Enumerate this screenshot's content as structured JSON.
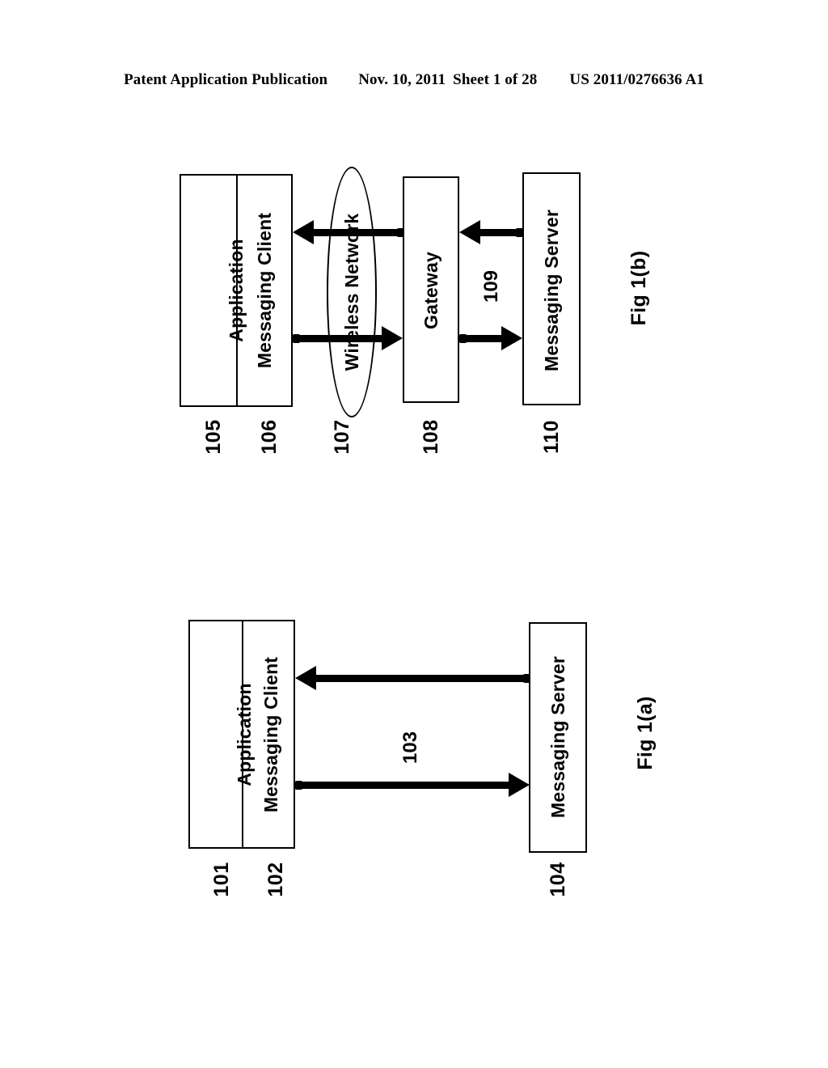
{
  "header": {
    "publication": "Patent Application Publication",
    "date": "Nov. 10, 2011",
    "sheet": "Sheet 1 of 28",
    "publication_number": "US 2011/0276636 A1"
  },
  "figures": [
    {
      "caption": "Fig 1(b)",
      "nodes": [
        {
          "label": "Application",
          "ref": "105"
        },
        {
          "label": "Messaging Client",
          "ref": "106"
        },
        {
          "label": "Wireless Network",
          "ref": "107"
        },
        {
          "label": "Gateway",
          "ref": "108"
        },
        {
          "label": "Messaging Server",
          "ref": "110"
        }
      ],
      "edge_labels": [
        "109"
      ]
    },
    {
      "caption": "Fig 1(a)",
      "nodes": [
        {
          "label": "Application",
          "ref": "101"
        },
        {
          "label": "Messaging Client",
          "ref": "102"
        },
        {
          "label": "Messaging Server",
          "ref": "104"
        }
      ],
      "edge_labels": [
        "103"
      ]
    }
  ],
  "colors": {
    "ink": "#000000",
    "paper": "#ffffff"
  }
}
